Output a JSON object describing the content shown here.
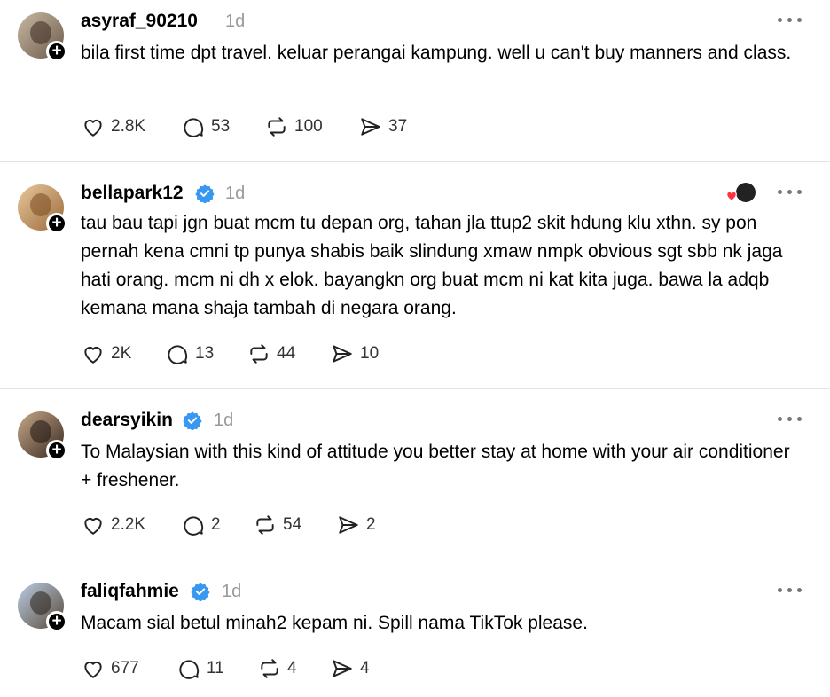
{
  "posts": [
    {
      "username": "asyraf_90210",
      "verified": false,
      "time": "1d",
      "text": "bila first time dpt travel. keluar perangai kampung. well u can't buy manners and class.",
      "likes": "2.8K",
      "replies": "53",
      "reposts": "100",
      "shares": "37"
    },
    {
      "username": "bellapark12",
      "verified": true,
      "time": "1d",
      "text": "tau bau tapi jgn buat mcm tu depan org, tahan jla ttup2 skit hdung klu xthn. sy pon pernah kena cmni tp punya shabis baik slindung xmaw nmpk obvious sgt sbb nk jaga hati orang. mcm ni dh x elok. bayangkn org buat mcm ni kat kita juga. bawa la adqb kemana mana shaja tambah di negara orang.",
      "likes": "2K",
      "replies": "13",
      "reposts": "44",
      "shares": "10"
    },
    {
      "username": "dearsyikin",
      "verified": true,
      "time": "1d",
      "text": "To Malaysian with this kind of attitude you better stay at home with your air conditioner + freshener.",
      "likes": "2.2K",
      "replies": "2",
      "reposts": "54",
      "shares": "2"
    },
    {
      "username": "faliqfahmie",
      "verified": true,
      "time": "1d",
      "text": "Macam sial betul minah2 kepam ni. Spill nama TikTok please.",
      "likes": "677",
      "replies": "11",
      "reposts": "4",
      "shares": "4"
    }
  ],
  "icons": {
    "like": "heart-icon",
    "reply": "comment-icon",
    "repost": "repost-icon",
    "share": "send-icon",
    "more": "more-icon",
    "verified": "verified-badge-icon",
    "follow": "plus-icon"
  },
  "colors": {
    "verified": "#3897f0",
    "like_reaction": "#ff3040",
    "muted": "#9a9a9a"
  }
}
